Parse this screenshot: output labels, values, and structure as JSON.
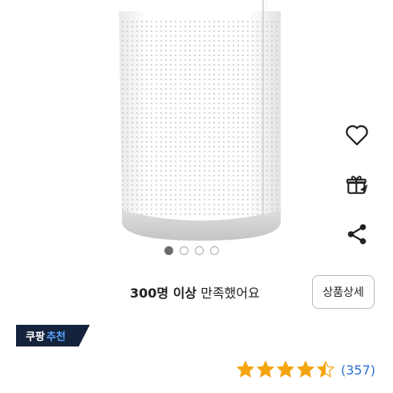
{
  "product": {
    "dots": {
      "count": 4,
      "active_index": 0
    },
    "satisfaction": {
      "count_text": "300명 이상",
      "rest_text": "만족했어요"
    },
    "detail_button_label": "상품상세",
    "badge": {
      "brand": "쿠팡",
      "highlight": "추천"
    },
    "rating": {
      "value": 4.5,
      "max": 5,
      "count_text": "(357)"
    }
  },
  "actions": {
    "icons": [
      "heart-icon",
      "gift-icon",
      "share-icon"
    ]
  },
  "colors": {
    "star": "#f4a410",
    "badge_bg": "#15223c",
    "badge_highlight": "#5aa6ff",
    "rating_count": "#2f6fd0",
    "icon": "#222222"
  }
}
